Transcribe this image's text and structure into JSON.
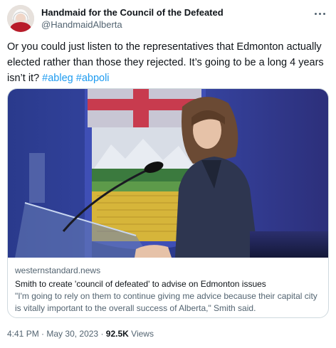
{
  "author": {
    "display_name": "Handmaid for the Council of the Defeated",
    "handle": "@HandmaidAlberta"
  },
  "tweet": {
    "text_before": "Or you could just listen to the representatives that Edmonton actually elected rather than those they rejected. It’s going to be a long 4 years isn’t it? ",
    "hashtags": [
      "#ableg",
      "#abpoli"
    ]
  },
  "card": {
    "domain": "westernstandard.news",
    "title": "Smith to create 'council of defeated' to advise on Edmonton issues",
    "description": "\"I'm going to rely on them to continue giving me advice because their capital city is vitally important to the overall success of Alberta,\" Smith said."
  },
  "footer": {
    "time": "4:41 PM",
    "separator": "·",
    "date": "May 30, 2023",
    "views_count": "92.5K",
    "views_label": "Views"
  },
  "colors": {
    "link": "#1d9bf0",
    "text": "#0f1419",
    "secondary": "#536471",
    "border": "#cfd9de"
  },
  "icons": [
    "more-options-icon"
  ]
}
